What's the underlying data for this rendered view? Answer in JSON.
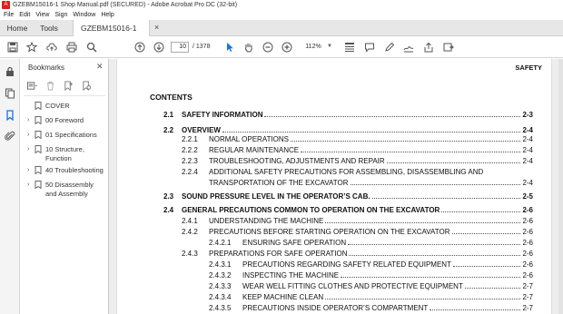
{
  "window": {
    "title": "GZEBM15016-1 Shop Manual.pdf (SECURED) - Adobe Acrobat Pro DC (32-bit)"
  },
  "menu": [
    "File",
    "Edit",
    "View",
    "Sign",
    "Window",
    "Help"
  ],
  "tabs": {
    "home": "Home",
    "tools": "Tools",
    "document": "GZEBM15016-1 Sh..."
  },
  "toolbar": {
    "page_current": "10",
    "page_total": "/ 1378",
    "zoom": "112%"
  },
  "bookmarks": {
    "title": "Bookmarks",
    "items": [
      {
        "label": "COVER",
        "expandable": false
      },
      {
        "label": "00 Foreword",
        "expandable": true
      },
      {
        "label": "01 Specifications",
        "expandable": true
      },
      {
        "label": "10 Structure, Function",
        "expandable": true
      },
      {
        "label": "40 Troubleshooting",
        "expandable": true
      },
      {
        "label": "50 Disassembly and Assembly",
        "expandable": true
      }
    ]
  },
  "document": {
    "section_header": "SAFETY",
    "contents_title": "CONTENTS",
    "toc": [
      {
        "num": "2.1",
        "text": "SAFETY INFORMATION",
        "page": "2-3",
        "level": 1
      },
      {
        "num": "2.2",
        "text": "OVERVIEW",
        "page": "2-4",
        "level": 1
      },
      {
        "num": "2.2.1",
        "text": "NORMAL OPERATIONS",
        "page": "2-4",
        "level": 2
      },
      {
        "num": "2.2.2",
        "text": "REGULAR MAINTENANCE",
        "page": "2-4",
        "level": 2
      },
      {
        "num": "2.2.3",
        "text": "TROUBLESHOOTING, ADJUSTMENTS AND REPAIR",
        "page": "2-4",
        "level": 2
      },
      {
        "num": "2.2.4",
        "text": "ADDITIONAL SAFETY PRECAUTIONS FOR ASSEMBLING, DISASSEMBLING AND",
        "page": "",
        "level": 2
      },
      {
        "num": "",
        "text": "TRANSPORTATION OF THE EXCAVATOR",
        "page": "2-4",
        "level": 2
      },
      {
        "num": "2.3",
        "text": "SOUND PRESSURE LEVEL IN THE OPERATOR’S CAB.",
        "page": "2-5",
        "level": 1
      },
      {
        "num": "2.4",
        "text": "GENERAL PRECAUTIONS COMMON TO OPERATION ON THE EXCAVATOR",
        "page": "2-6",
        "level": 1
      },
      {
        "num": "2.4.1",
        "text": "UNDERSTANDING THE MACHINE",
        "page": "2-6",
        "level": 2
      },
      {
        "num": "2.4.2",
        "text": "PRECAUTIONS BEFORE STARTING OPERATION ON THE EXCAVATOR",
        "page": "2-6",
        "level": 2
      },
      {
        "num": "2.4.2.1",
        "text": "ENSURING SAFE OPERATION",
        "page": "2-6",
        "level": 3
      },
      {
        "num": "2.4.3",
        "text": "PREPARATIONS FOR SAFE OPERATION",
        "page": "2-6",
        "level": 2
      },
      {
        "num": "2.4.3.1",
        "text": "PRECAUTIONS REGARDING SAFETY RELATED EQUIPMENT",
        "page": "2-6",
        "level": 3
      },
      {
        "num": "2.4.3.2",
        "text": "INSPECTING THE MACHINE",
        "page": "2-6",
        "level": 3
      },
      {
        "num": "2.4.3.3",
        "text": "WEAR WELL FITTING CLOTHES AND PROTECTIVE EQUIPMENT",
        "page": "2-7",
        "level": 3
      },
      {
        "num": "2.4.3.4",
        "text": "KEEP MACHINE CLEAN",
        "page": "2-7",
        "level": 3
      },
      {
        "num": "2.4.3.5",
        "text": "PRECAUTIONS INSIDE OPERATOR’S COMPARTMENT",
        "page": "2-7",
        "level": 3
      }
    ]
  },
  "colors": {
    "accent": "#1473e6",
    "app_red": "#d4241c"
  }
}
